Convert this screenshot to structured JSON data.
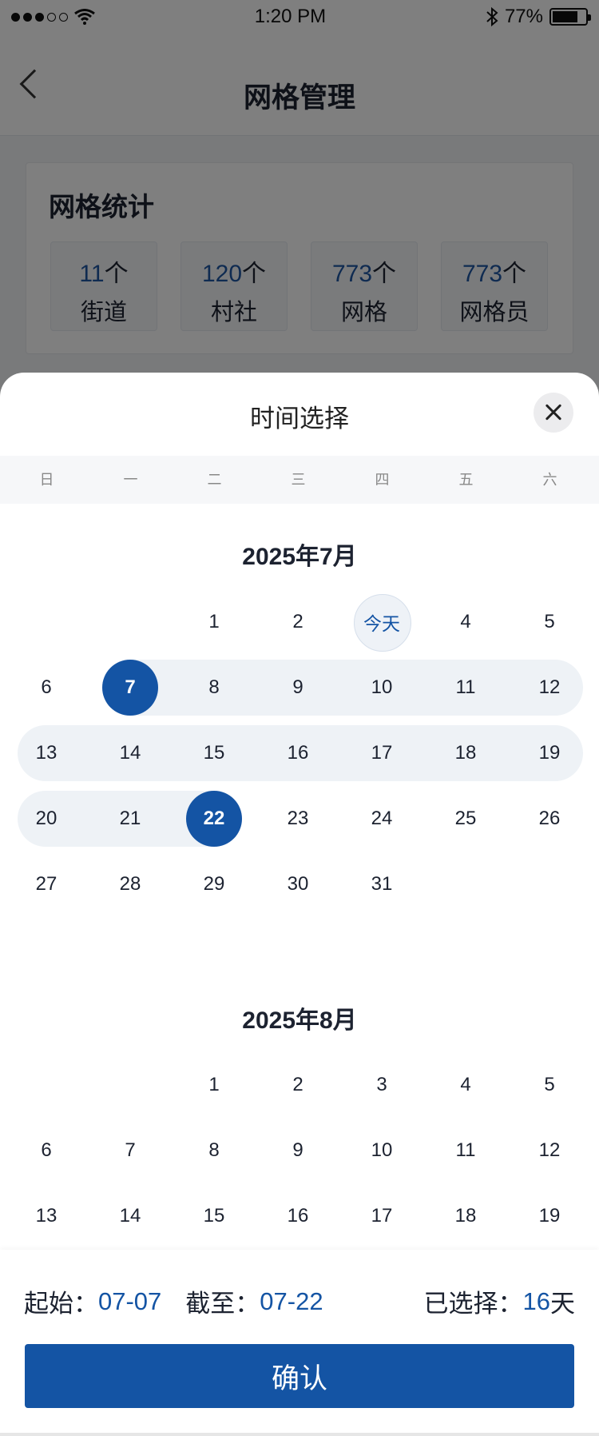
{
  "status_bar": {
    "time": "1:20 PM",
    "battery": "77%",
    "battery_level": 0.77
  },
  "header": {
    "title": "网格管理"
  },
  "stats": {
    "title": "网格统计",
    "items": [
      {
        "value": "11",
        "unit": "个",
        "label": "街道"
      },
      {
        "value": "120",
        "unit": "个",
        "label": "村社"
      },
      {
        "value": "773",
        "unit": "个",
        "label": "网格"
      },
      {
        "value": "773",
        "unit": "个",
        "label": "网格员"
      }
    ]
  },
  "picker": {
    "title": "时间选择",
    "weekdays": [
      "日",
      "一",
      "二",
      "三",
      "四",
      "五",
      "六"
    ],
    "today_label": "今天",
    "months": [
      {
        "title": "2025年7月",
        "first_weekday": 2,
        "days": 31,
        "today": 3,
        "range_start": 7,
        "range_end": 22
      },
      {
        "title": "2025年8月",
        "first_weekday": 2,
        "days": 31,
        "visible_until": 19
      }
    ]
  },
  "footer": {
    "start_label": "起始：",
    "start_value": "07-07",
    "end_label": "截至：",
    "end_value": "07-22",
    "selected_label": "已选择：",
    "selected_value": "16",
    "selected_unit": "天",
    "confirm": "确认"
  },
  "colors": {
    "accent": "#1454a4",
    "range": "#eef2f6"
  }
}
